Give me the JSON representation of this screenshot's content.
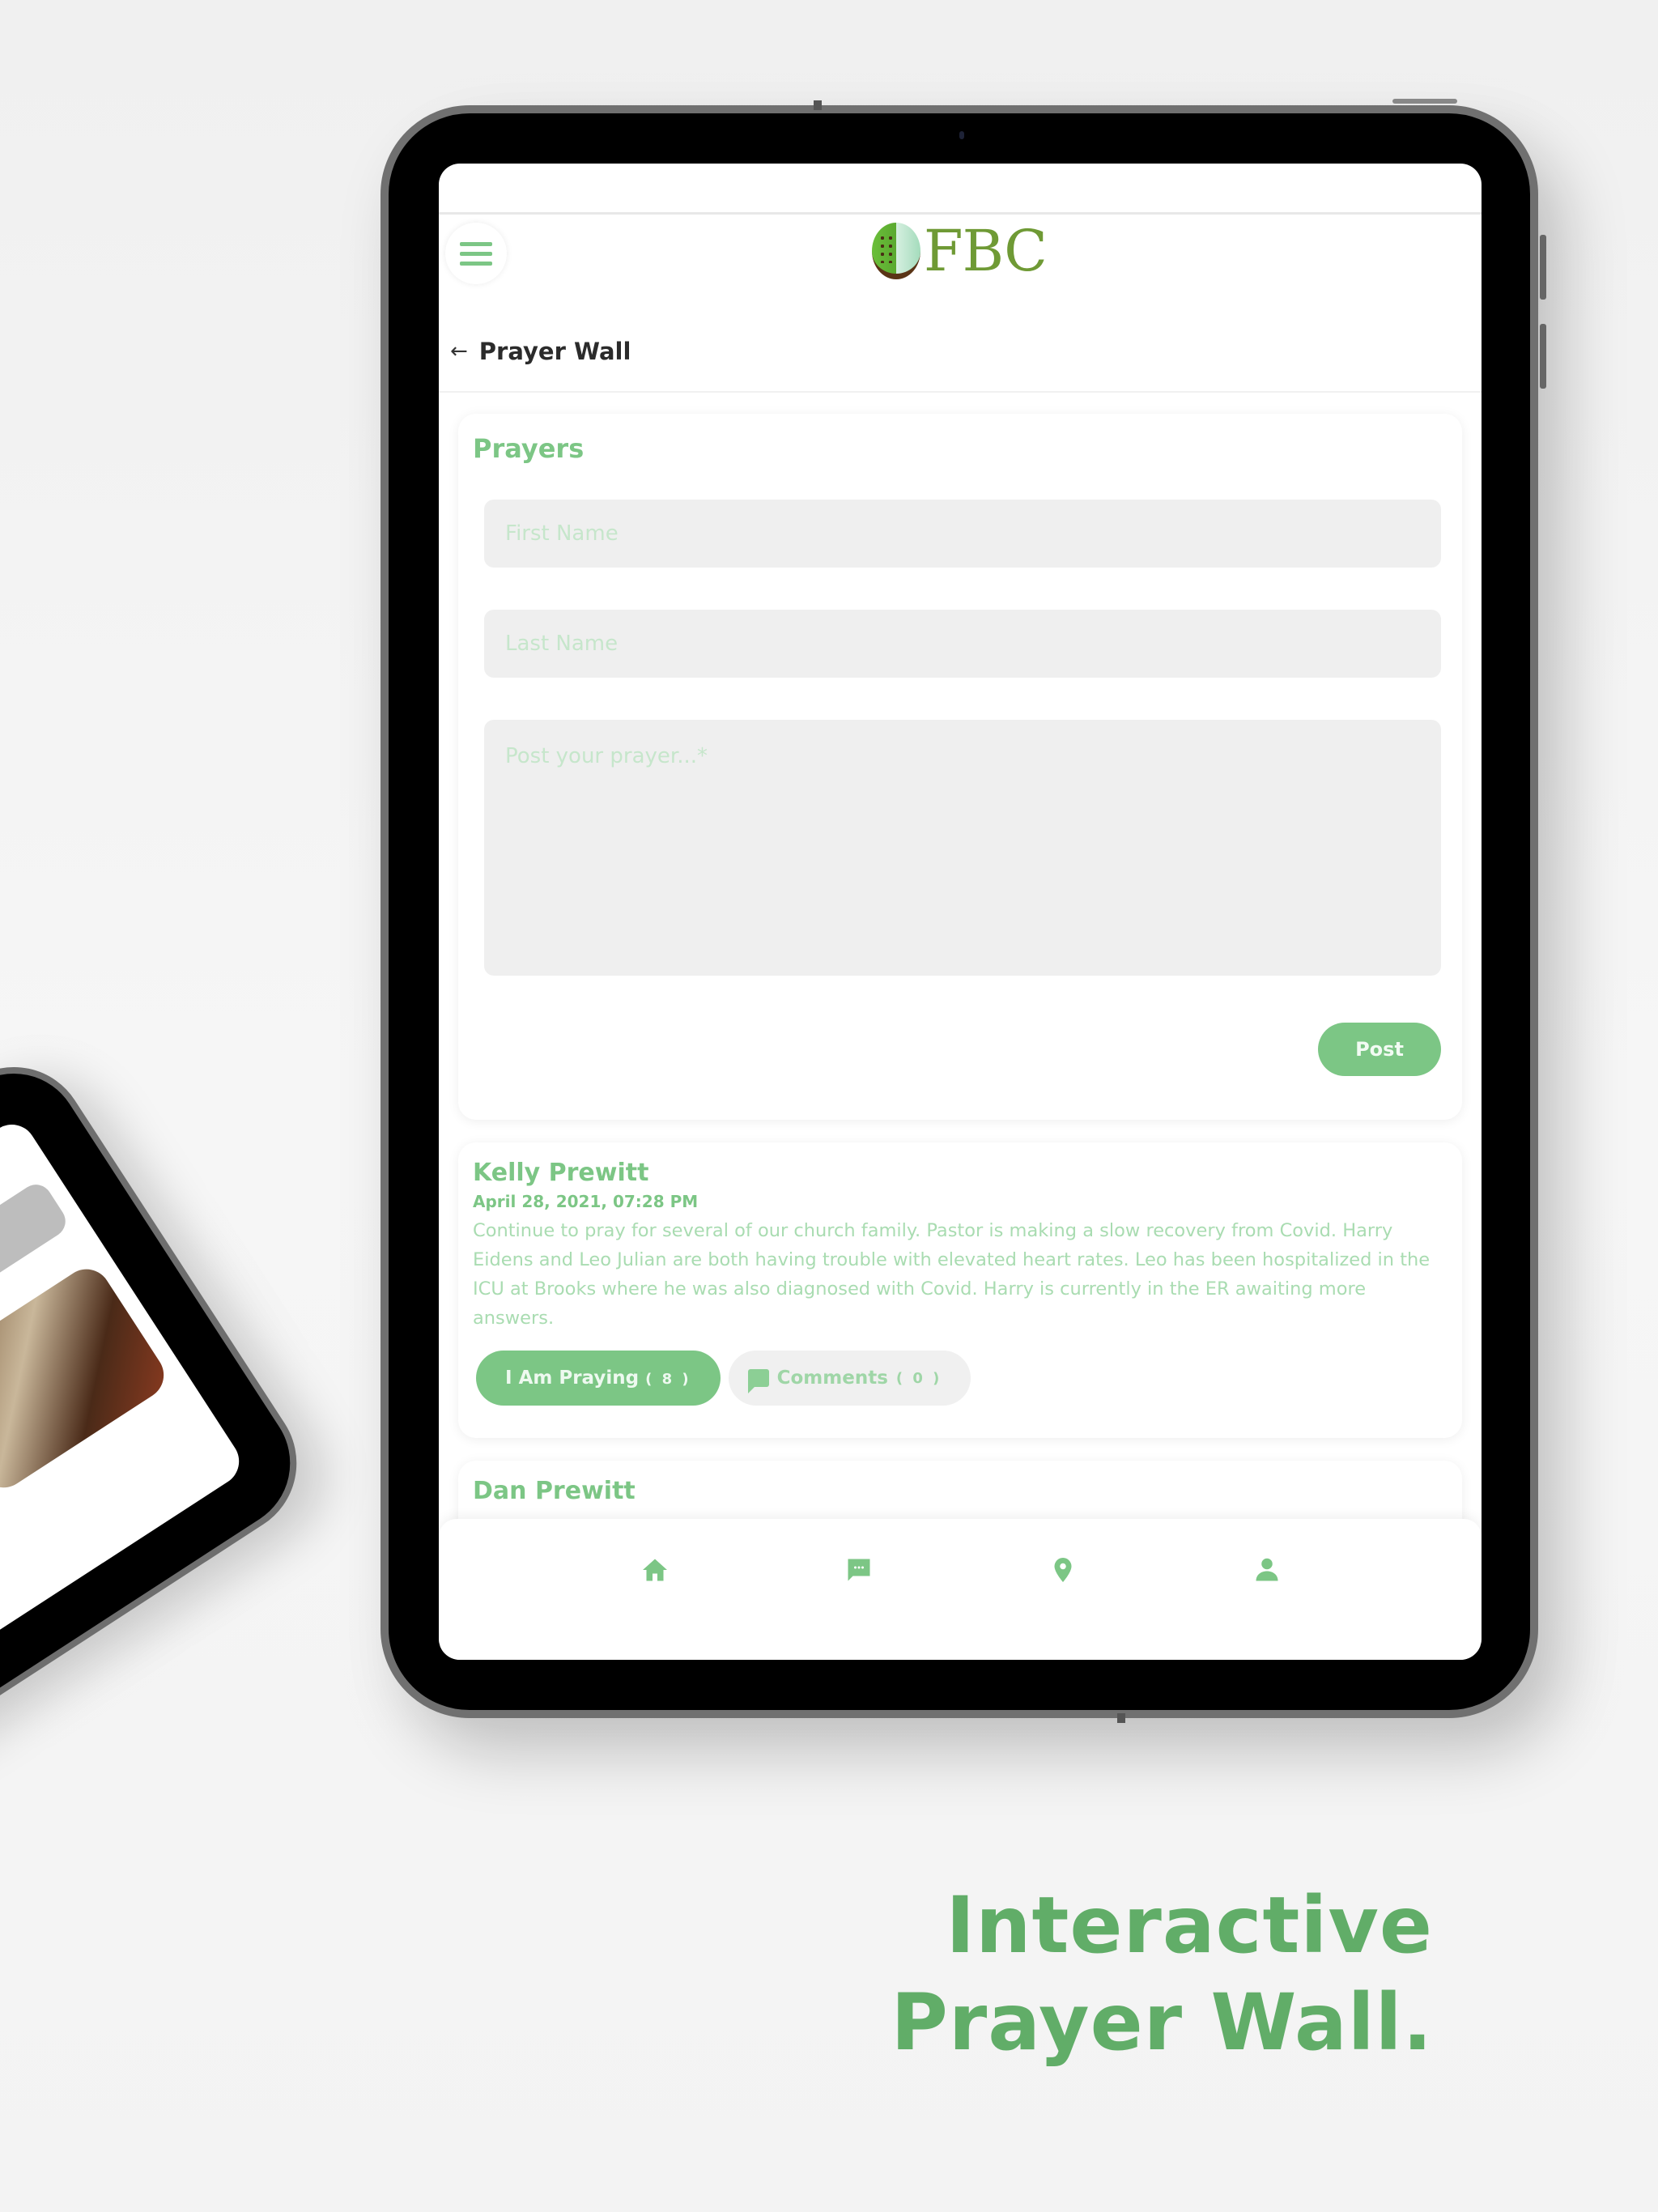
{
  "app": {
    "logo_text": "FBC",
    "brand_color": "#7cc685",
    "tagline_color": "#61ad68"
  },
  "header": {
    "menu_icon": "hamburger-menu-icon",
    "back_icon": "arrow-left-icon",
    "back_glyph": "←",
    "page_title": "Prayer Wall"
  },
  "form": {
    "title": "Prayers",
    "first_name_placeholder": "First Name",
    "last_name_placeholder": "Last Name",
    "prayer_placeholder": "Post your prayer...*",
    "post_label": "Post"
  },
  "prayers": [
    {
      "name": "Kelly Prewitt",
      "date": "April 28, 2021, 07:28 PM",
      "text": "Continue to pray for several of our church family. Pastor is making a slow recovery from Covid. Harry Eidens and Leo Julian are both having trouble with elevated heart rates. Leo has been hospitalized in the ICU at Brooks where he was also diagnosed with Covid. Harry is currently in the ER awaiting more answers.",
      "praying_label": "I Am Praying",
      "praying_count": "( 8 )",
      "comments_label": "Comments",
      "comments_count": "( 0 )"
    },
    {
      "name": "Dan Prewitt"
    }
  ],
  "bottom_nav": [
    {
      "icon": "home-icon"
    },
    {
      "icon": "chat-icon"
    },
    {
      "icon": "map-pin-icon"
    },
    {
      "icon": "profile-icon"
    }
  ],
  "tagline": {
    "line1": "Interactive",
    "line2": "Prayer Wall."
  }
}
